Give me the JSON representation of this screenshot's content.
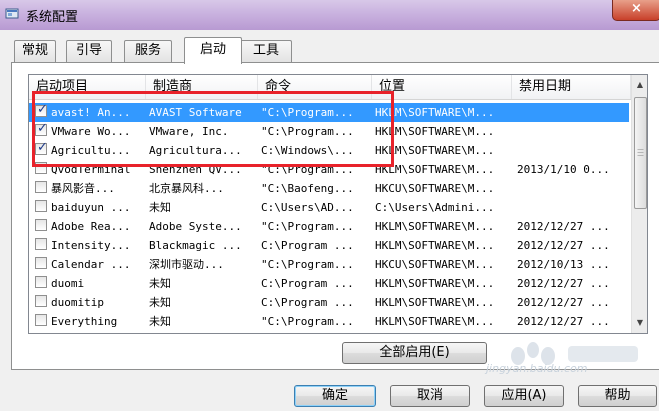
{
  "window": {
    "title": "系统配置",
    "close_label": "×"
  },
  "tabs": [
    {
      "label": "常规",
      "active": false
    },
    {
      "label": "引导",
      "active": false
    },
    {
      "label": "服务",
      "active": false
    },
    {
      "label": "启动",
      "active": true
    },
    {
      "label": "工具",
      "active": false
    }
  ],
  "list": {
    "columns": [
      "启动项目",
      "制造商",
      "命令",
      "位置",
      "禁用日期"
    ],
    "rows": [
      {
        "checked": true,
        "selected": true,
        "item": "avast! An...",
        "maker": "AVAST Software",
        "command": "\"C:\\Program...",
        "location": "HKLM\\SOFTWARE\\M...",
        "date": ""
      },
      {
        "checked": true,
        "selected": false,
        "item": "VMware Wo...",
        "maker": "VMware, Inc.",
        "command": "\"C:\\Program...",
        "location": "HKLM\\SOFTWARE\\M...",
        "date": ""
      },
      {
        "checked": true,
        "selected": false,
        "item": "Agricultu...",
        "maker": "Agricultura...",
        "command": "C:\\Windows\\...",
        "location": "HKLM\\SOFTWARE\\M...",
        "date": ""
      },
      {
        "checked": false,
        "selected": false,
        "item": "QvodTerminal",
        "maker": "Shenzhen QV...",
        "command": "\"C:\\Program...",
        "location": "HKLM\\SOFTWARE\\M...",
        "date": "2013/1/10 0..."
      },
      {
        "checked": false,
        "selected": false,
        "item": "暴风影音...",
        "maker": "北京暴风科...",
        "command": "\"C:\\Baofeng...",
        "location": "HKCU\\SOFTWARE\\M...",
        "date": ""
      },
      {
        "checked": false,
        "selected": false,
        "item": "baiduyun ...",
        "maker": "未知",
        "command": "C:\\Users\\AD...",
        "location": "C:\\Users\\Admini...",
        "date": ""
      },
      {
        "checked": false,
        "selected": false,
        "item": "Adobe Rea...",
        "maker": "Adobe Syste...",
        "command": "\"C:\\Program...",
        "location": "HKLM\\SOFTWARE\\M...",
        "date": "2012/12/27 ..."
      },
      {
        "checked": false,
        "selected": false,
        "item": "Intensity...",
        "maker": "Blackmagic ...",
        "command": "C:\\Program ...",
        "location": "HKLM\\SOFTWARE\\M...",
        "date": "2012/12/27 ..."
      },
      {
        "checked": false,
        "selected": false,
        "item": "Calendar ...",
        "maker": "深圳市驱动...",
        "command": "\"C:\\Program...",
        "location": "HKCU\\SOFTWARE\\M...",
        "date": "2012/10/13 ..."
      },
      {
        "checked": false,
        "selected": false,
        "item": "duomi",
        "maker": "未知",
        "command": "C:\\Program ...",
        "location": "HKLM\\SOFTWARE\\M...",
        "date": "2012/12/27 ..."
      },
      {
        "checked": false,
        "selected": false,
        "item": "duomitip",
        "maker": "未知",
        "command": "C:\\Program ...",
        "location": "HKLM\\SOFTWARE\\M...",
        "date": "2012/12/27 ..."
      },
      {
        "checked": false,
        "selected": false,
        "item": "Everything",
        "maker": "未知",
        "command": "\"C:\\Program...",
        "location": "HKLM\\SOFTWARE\\M...",
        "date": "2012/12/27 ..."
      }
    ]
  },
  "buttons": {
    "enable_all": "全部启用(E)",
    "ok": "确定",
    "cancel": "取消",
    "apply": "应用(A)",
    "help": "帮助"
  },
  "watermark": "jingyan.baidu.com",
  "icons": {
    "title": "msconfig-icon",
    "scroll_up": "arrow-up-icon",
    "scroll_down": "arrow-down-icon"
  }
}
